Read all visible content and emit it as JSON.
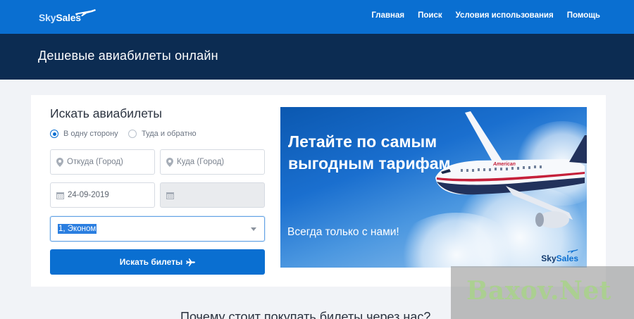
{
  "brand": {
    "logo_part1": "Sky",
    "logo_part2": "Sales"
  },
  "nav": {
    "items": [
      "Главная",
      "Поиск",
      "Условия использования",
      "Помощь"
    ]
  },
  "hero": {
    "title": "Дешевые авиабилеты онлайн"
  },
  "search_form": {
    "title": "Искать авиабилеты",
    "trip_options": [
      {
        "label": "В одну сторону",
        "selected": true
      },
      {
        "label": "Туда и обратно",
        "selected": false
      }
    ],
    "from_placeholder": "Откуда (Город)",
    "to_placeholder": "Куда (Город)",
    "depart_date": "24-09-2019",
    "return_date": "",
    "passengers_class": "1, Эконом",
    "submit_label": "Искать билеты"
  },
  "banner": {
    "headline": "Летайте по самым выгодным тарифам",
    "subline": "Всегда только с нами!",
    "aircraft_label": "American",
    "logo_part1": "Sky",
    "logo_part2": "Sales"
  },
  "section": {
    "why_title": "Почему стоит покупать билеты через нас?"
  },
  "watermark": {
    "text": "Baxov.Net"
  },
  "colors": {
    "primary": "#0a6fd1",
    "hero_bg": "#0c2c52",
    "page_bg": "#f1f3f7"
  }
}
